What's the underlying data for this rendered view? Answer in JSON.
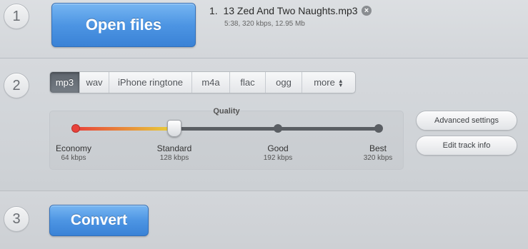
{
  "steps": [
    "1",
    "2",
    "3"
  ],
  "open_button": {
    "label": "Open files"
  },
  "file": {
    "index": "1.",
    "name": "13 Zed And Two Naughts.mp3",
    "meta": "5:38, 320 kbps, 12.95 Mb",
    "remove_icon": "×"
  },
  "formats": {
    "selected": "mp3",
    "tabs": [
      "mp3",
      "wav",
      "iPhone ringtone",
      "m4a",
      "flac",
      "ogg",
      "more"
    ],
    "more_icon": "up-down-arrows"
  },
  "quality": {
    "title": "Quality",
    "selected": "Standard",
    "levels": [
      {
        "name": "Economy",
        "bitrate": "64 kbps"
      },
      {
        "name": "Standard",
        "bitrate": "128 kbps"
      },
      {
        "name": "Good",
        "bitrate": "192 kbps"
      },
      {
        "name": "Best",
        "bitrate": "320 kbps"
      }
    ]
  },
  "buttons": {
    "advanced": "Advanced settings",
    "edit_info": "Edit track info"
  },
  "convert_button": {
    "label": "Convert"
  },
  "colors": {
    "accent_blue": "#4d95e3",
    "track_red": "#e8413a",
    "track_yellow": "#e8d23a",
    "track_gray": "#5a5e63",
    "active_tab": "#666d75"
  }
}
